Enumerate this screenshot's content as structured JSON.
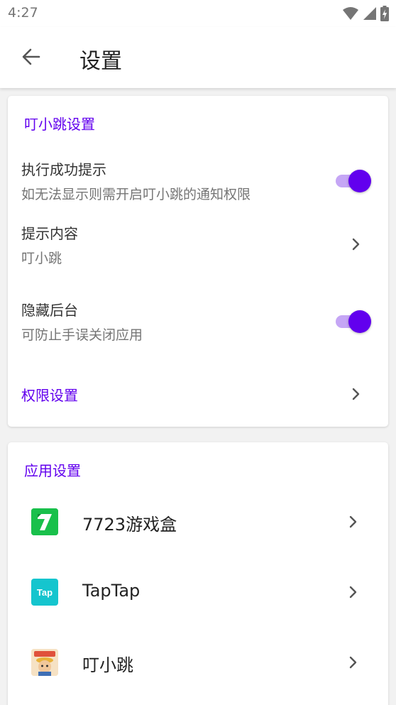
{
  "status_bar": {
    "time": "4:27"
  },
  "app_bar": {
    "title": "设置"
  },
  "section_1": {
    "title": "叮小跳设置",
    "success_tip": {
      "title": "执行成功提示",
      "subtitle": "如无法显示则需开启叮小跳的通知权限",
      "enabled": true
    },
    "tip_content": {
      "title": "提示内容",
      "value": "叮小跳"
    },
    "hide_background": {
      "title": "隐藏后台",
      "subtitle": "可防止手误关闭应用",
      "enabled": true
    },
    "permission": {
      "label": "权限设置"
    }
  },
  "section_2": {
    "title": "应用设置",
    "apps": [
      {
        "name": "7723游戏盒",
        "icon": "7723-game-box-icon",
        "icon_text": "7"
      },
      {
        "name": "TapTap",
        "icon": "taptap-icon",
        "icon_text": "Tap"
      },
      {
        "name": "叮小跳",
        "icon": "dingxiaotiao-icon",
        "icon_text": ""
      }
    ]
  },
  "colors": {
    "accent": "#6200ee",
    "switch_track": "#c5a6f5",
    "icon_7723": "#19c04b",
    "icon_taptap": "#15c5ce"
  }
}
